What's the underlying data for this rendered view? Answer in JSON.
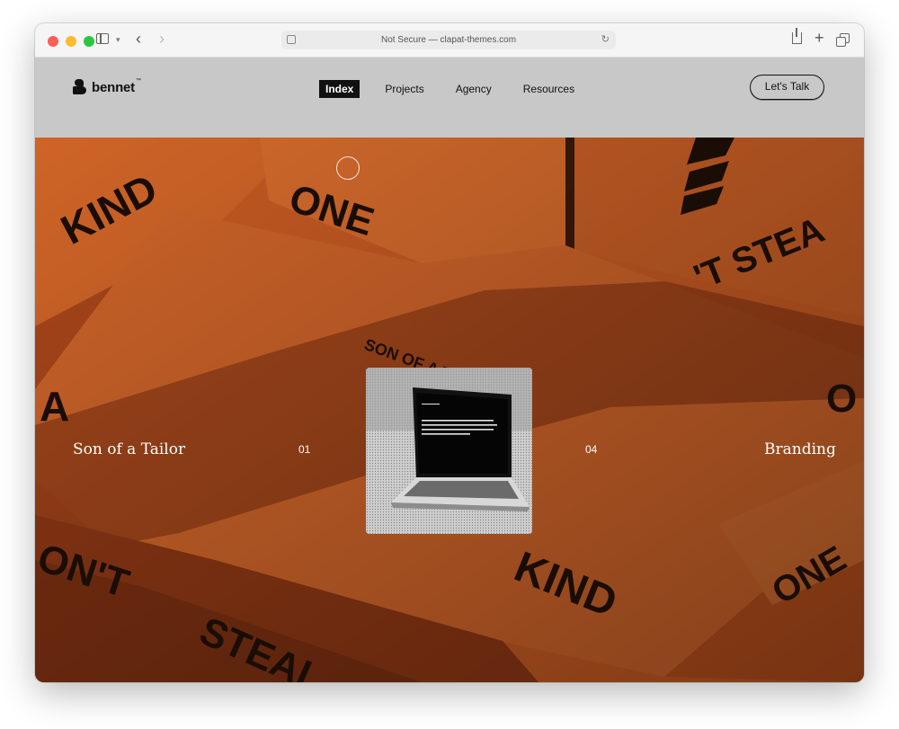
{
  "browser": {
    "address": "Not Secure — clapat-themes.com"
  },
  "site": {
    "logo_text": "bennet",
    "logo_tm": "™",
    "nav": [
      {
        "label": "Index",
        "active": true
      },
      {
        "label": "Projects",
        "active": false
      },
      {
        "label": "Agency",
        "active": false
      },
      {
        "label": "Resources",
        "active": false
      }
    ],
    "cta_label": "Let's Talk"
  },
  "hero": {
    "project_title": "Son of a Tailor",
    "project_index": "01",
    "project_total": "04",
    "project_category": "Branding",
    "box_prints": [
      "KIND",
      "ONE",
      "A",
      "'T STEA",
      "ON'T",
      "STEAL",
      "KIND",
      "ONE",
      "SON OF A TAILOR",
      "O"
    ]
  },
  "colors": {
    "accent_orange": "#c3541d",
    "header_gray": "#c8c8c8",
    "text_dark": "#111111"
  }
}
